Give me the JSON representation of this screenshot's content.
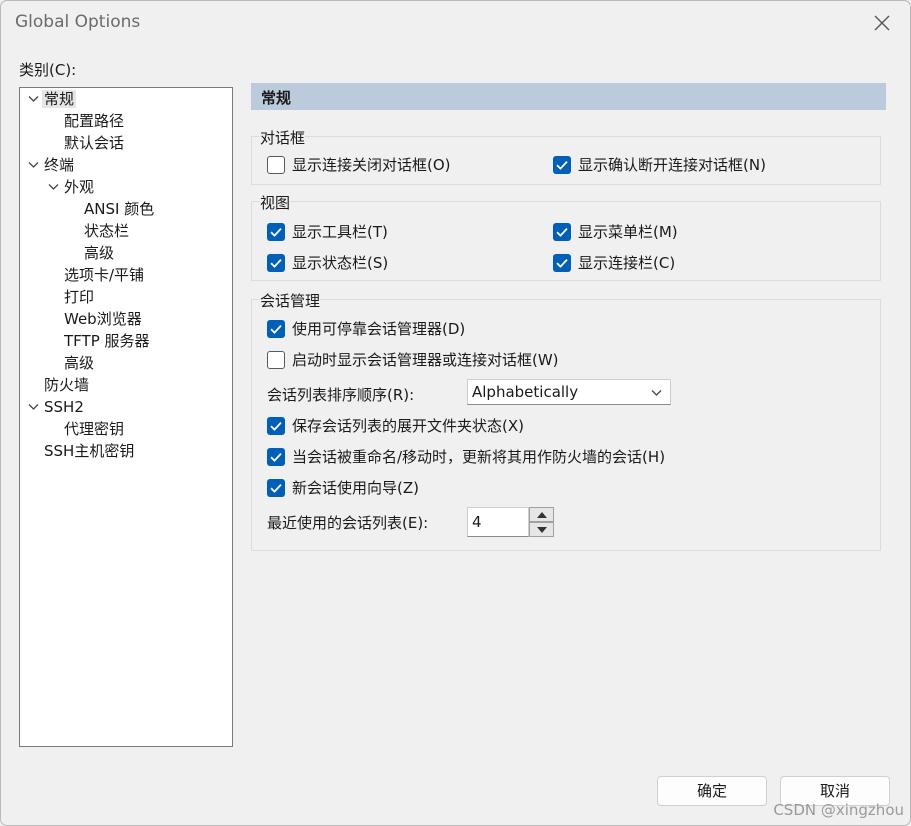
{
  "window": {
    "title": "Global Options"
  },
  "category_label": "类别(C):",
  "tree": [
    "常规",
    "配置路径",
    "默认会话",
    "终端",
    "外观",
    "ANSI 颜色",
    "状态栏",
    "高级",
    "选项卡/平铺",
    "打印",
    "Web浏览器",
    "TFTP 服务器",
    "高级",
    "防火墙",
    "SSH2",
    "代理密钥",
    "SSH主机密钥"
  ],
  "section_title": "常规",
  "dialog_group": {
    "title": "对话框",
    "items": [
      {
        "label": "显示连接关闭对话框(O)",
        "checked": false
      },
      {
        "label": "显示确认断开连接对话框(N)",
        "checked": true
      }
    ]
  },
  "view_group": {
    "title": "视图",
    "items": [
      {
        "label": "显示工具栏(T)",
        "checked": true
      },
      {
        "label": "显示菜单栏(M)",
        "checked": true
      },
      {
        "label": "显示状态栏(S)",
        "checked": true
      },
      {
        "label": "显示连接栏(C)",
        "checked": true
      }
    ]
  },
  "session_group": {
    "title": "会话管理",
    "items": [
      {
        "label": "使用可停靠会话管理器(D)",
        "checked": true
      },
      {
        "label": "启动时显示会话管理器或连接对话框(W)",
        "checked": false
      },
      {
        "label": "保存会话列表的展开文件夹状态(X)",
        "checked": true
      },
      {
        "label": "当会话被重命名/移动时，更新将其用作防火墙的会话(H)",
        "checked": true
      },
      {
        "label": "新会话使用向导(Z)",
        "checked": true
      }
    ],
    "sort_label": "会话列表排序顺序(R):",
    "sort_value": "Alphabetically",
    "recent_label": "最近使用的会话列表(E):",
    "recent_value": "4"
  },
  "buttons": {
    "ok": "确定",
    "cancel": "取消"
  },
  "watermark": "CSDN @xingzhou",
  "colors": {
    "accent": "#005fb8",
    "header": "#bccbdc"
  }
}
